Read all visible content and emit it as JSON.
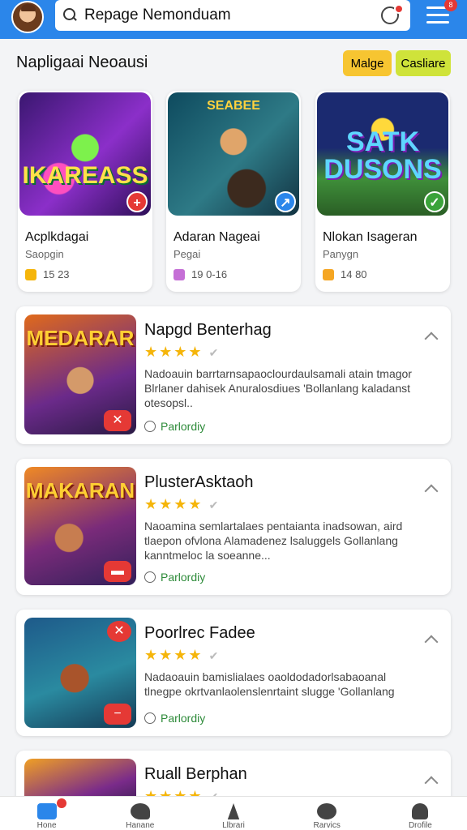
{
  "header": {
    "search_value": "Repage Nemonduam",
    "menu_badge": "8"
  },
  "section": {
    "title": "Napligaai Neoausi",
    "button_a": "Malge",
    "button_b": "Casliare"
  },
  "cards": [
    {
      "art_text": "IKAREASS",
      "name": "Acplkdagai",
      "sub": "Saopgin",
      "stat": "15 23",
      "corner": "+",
      "corner_color": "#e53935",
      "stat_color": "#f5b50a"
    },
    {
      "art_text": "SEABEE",
      "name": "Adaran Nageai",
      "sub": "Pegai",
      "stat": "19 0-16",
      "corner": "↗",
      "corner_color": "#2b86ea",
      "stat_color": "#c56fd6"
    },
    {
      "art_text": "SATK DUSONS",
      "name": "Nlokan Isageran",
      "sub": "Panygn",
      "stat": "14 80",
      "corner": "✓",
      "corner_color": "#3aa33a",
      "stat_color": "#f5a623"
    }
  ],
  "list": [
    {
      "thumb_text": "MEDARAR",
      "title": "Napgd Benterhag",
      "stars": "★★★★",
      "desc": "Nadoauin barrtarnsapaoclourdaulsamali atain tmagor Blrlaner dahisek Anuralosdiues 'Bollanlang kaladanst otesopsl..",
      "status": "Parlordiy",
      "badge": "✕"
    },
    {
      "thumb_text": "MAKARAN",
      "title": "PlusterAsktaoh",
      "stars": "★★★★",
      "desc": "Naoamina semlartalaes pentaianta inadsowan, aird tlaepon ofvlona Alamadenez lsaluggels Gollanlang kanntmeloc la soeanne...",
      "status": "Parlordiy",
      "badge": "▬"
    },
    {
      "thumb_text": "",
      "title": "Poorlrec Fadee",
      "stars": "★★★★",
      "desc": "Nadaoauin bamislialaes oaoldodadorlsabaoanal tlnegpe okrtvanlaolenslenrtaint slugge 'Gollanlang",
      "status": "Parlordiy",
      "badge": "−"
    },
    {
      "thumb_text": "",
      "title": "Ruall Berphan",
      "stars": "★★★★",
      "desc": "",
      "status": "",
      "badge": ""
    }
  ],
  "nav": [
    {
      "label": "Hone"
    },
    {
      "label": "Hanane"
    },
    {
      "label": "Llbrari"
    },
    {
      "label": "Rarvics"
    },
    {
      "label": "Drofile"
    }
  ],
  "colors": {
    "accent": "#2b86ea",
    "danger": "#e53935",
    "success": "#2e8b3a"
  }
}
